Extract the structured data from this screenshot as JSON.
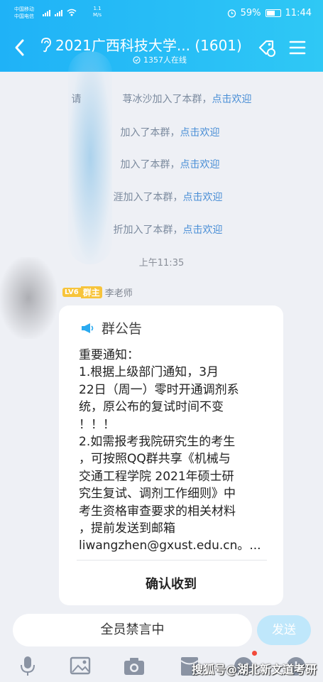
{
  "status": {
    "carrier1": "中国移动",
    "carrier2": "中国电信",
    "net_speed": "1.1",
    "net_unit": "M/s",
    "battery": "59%",
    "time": "11:44"
  },
  "header": {
    "title": "2021广西科技大学...  (1601)",
    "online": "1357人在线"
  },
  "system_messages": [
    {
      "name": "荨冰沙",
      "text": "加入了本群，",
      "link": "点击欢迎"
    },
    {
      "name": "",
      "text": "加入了本群，",
      "link": "点击欢迎"
    },
    {
      "name": "",
      "text": "加入了本群，",
      "link": "点击欢迎"
    },
    {
      "name": "涯",
      "text": "加入了本群，",
      "link": "点击欢迎"
    },
    {
      "name": "折",
      "text": "加入了本群，",
      "link": "点击欢迎"
    }
  ],
  "system_prefix": "请",
  "timestamp": "上午11:35",
  "sender": {
    "level": "LV6",
    "role": "群主",
    "name": "李老师"
  },
  "announcement": {
    "header": "群公告",
    "lines": [
      "重要通知：",
      "1.根据上级部门通知，3月",
      "22日（周一）零时开通调剂系",
      "统，原公布的复试时间不变",
      "！！！",
      "2.如需报考我院研究生的考生",
      "，可按照QQ群共享《机械与",
      "交通工程学院 2021年硕士研",
      "究生复试、调剂工作细则》中",
      "考生资格审查要求的相关材料",
      "，提前发送到邮箱",
      "liwangzhen@gxust.edu.cn。..."
    ],
    "confirm": "确认收到"
  },
  "input": {
    "placeholder": "全员禁言中",
    "send": "发送"
  },
  "watermark": "搜狐号@湖北新文道考研",
  "colors": {
    "header": "#1fb2f7",
    "link": "#4b8fd6",
    "badge": "#f7c43b"
  }
}
